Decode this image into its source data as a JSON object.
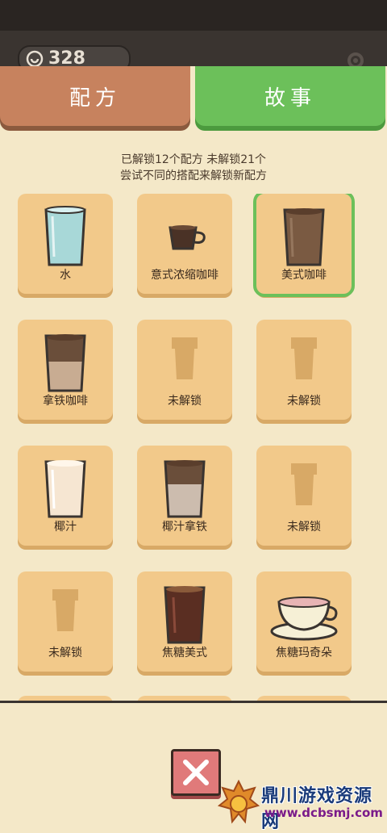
{
  "header": {
    "coins": "328"
  },
  "tabs": [
    {
      "label": "配方"
    },
    {
      "label": "故事"
    }
  ],
  "info": {
    "line1": "已解锁12个配方 未解锁21个",
    "line2": "尝试不同的搭配来解锁新配方"
  },
  "recipes": [
    {
      "label": "水"
    },
    {
      "label": "意式浓缩咖啡"
    },
    {
      "label": "美式咖啡"
    },
    {
      "label": "拿铁咖啡"
    },
    {
      "label": "未解锁"
    },
    {
      "label": "未解锁"
    },
    {
      "label": "椰汁"
    },
    {
      "label": "椰汁拿铁"
    },
    {
      "label": "未解锁"
    },
    {
      "label": "未解锁"
    },
    {
      "label": "焦糖美式"
    },
    {
      "label": "焦糖玛奇朵"
    }
  ],
  "watermark": {
    "title": "鼎川游戏资源网",
    "url": "www.dcbsmj.com"
  },
  "colors": {
    "recipe_tab": "#c7825e",
    "story_tab": "#6cc05a",
    "card": "#f2c98a",
    "selected_outline": "#6cc05a",
    "close": "#e07a7a"
  }
}
